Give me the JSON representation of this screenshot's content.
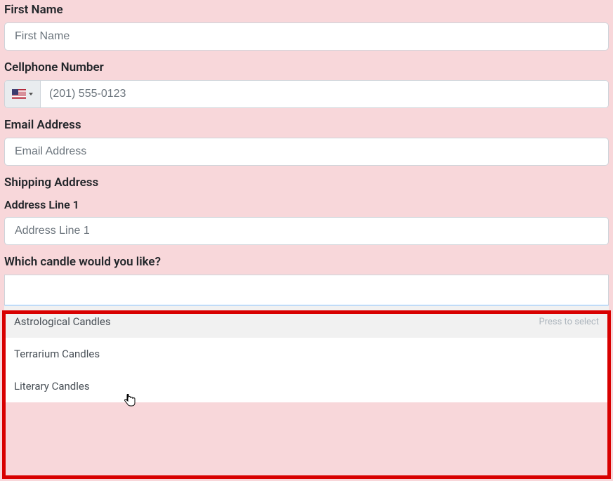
{
  "first_name": {
    "label": "First Name",
    "placeholder": "First Name",
    "value": ""
  },
  "cellphone": {
    "label": "Cellphone Number",
    "placeholder": "(201) 555-0123",
    "value": "",
    "country_flag": "us-flag"
  },
  "email": {
    "label": "Email Address",
    "placeholder": "Email Address",
    "value": ""
  },
  "shipping": {
    "label": "Shipping Address",
    "line1_label": "Address Line 1",
    "line1_placeholder": "Address Line 1",
    "line1_value": ""
  },
  "candle": {
    "label": "Which candle would you like?",
    "input_value": "",
    "press_hint": "Press to select",
    "options": [
      {
        "label": "Astrological Candles",
        "hovered": true
      },
      {
        "label": "Terrarium Candles",
        "hovered": false
      },
      {
        "label": "Literary Candles",
        "hovered": false
      }
    ]
  }
}
